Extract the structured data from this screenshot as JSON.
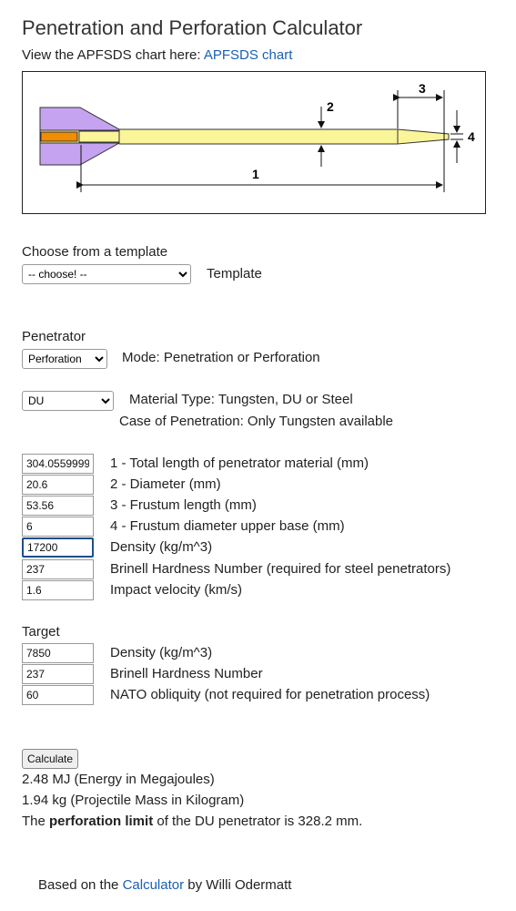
{
  "page": {
    "title": "Penetration and Perforation Calculator",
    "chart_prefix": "View the APFSDS chart here: ",
    "chart_link": "APFSDS chart"
  },
  "diagram": {
    "labels": [
      "1",
      "2",
      "3",
      "4"
    ],
    "colors": {
      "fins": "#c6a3f0",
      "rod": "#fbf59a",
      "core": "#f28c00"
    }
  },
  "template": {
    "heading": "Choose from a template",
    "select_value": "-- choose! --",
    "label": "Template"
  },
  "penetrator": {
    "heading": "Penetrator",
    "mode_value": "Perforation",
    "mode_label": "Mode: Penetration or Perforation",
    "material_value": "DU",
    "material_label": "Material Type: Tungsten, DU or Steel",
    "material_note": "Case of Penetration: Only Tungsten available",
    "fields": [
      {
        "value": "304.0559999",
        "label": "1 - Total length of penetrator material (mm)"
      },
      {
        "value": "20.6",
        "label": "2 - Diameter (mm)"
      },
      {
        "value": "53.56",
        "label": "3 - Frustum length (mm)"
      },
      {
        "value": "6",
        "label": "4 - Frustum diameter upper base (mm)"
      },
      {
        "value": "17200",
        "label": "Density (kg/m^3)"
      },
      {
        "value": "237",
        "label": "Brinell Hardness Number (required for steel penetrators)"
      },
      {
        "value": "1.6",
        "label": "Impact velocity (km/s)"
      }
    ]
  },
  "target": {
    "heading": "Target",
    "fields": [
      {
        "value": "7850",
        "label": "Density (kg/m^3)"
      },
      {
        "value": "237",
        "label": "Brinell Hardness Number"
      },
      {
        "value": "60",
        "label": "NATO obliquity (not required for penetration process)"
      }
    ]
  },
  "results": {
    "button": "Calculate",
    "energy": "2.48 MJ (Energy in Megajoules)",
    "mass": "1.94 kg (Projectile Mass in Kilogram)",
    "limit_prefix": "The ",
    "limit_bold": "perforation limit",
    "limit_suffix": " of the DU penetrator is 328.2 mm."
  },
  "footer": {
    "prefix": "Based on the ",
    "link": "Calculator",
    "suffix": " by Willi Odermatt"
  }
}
